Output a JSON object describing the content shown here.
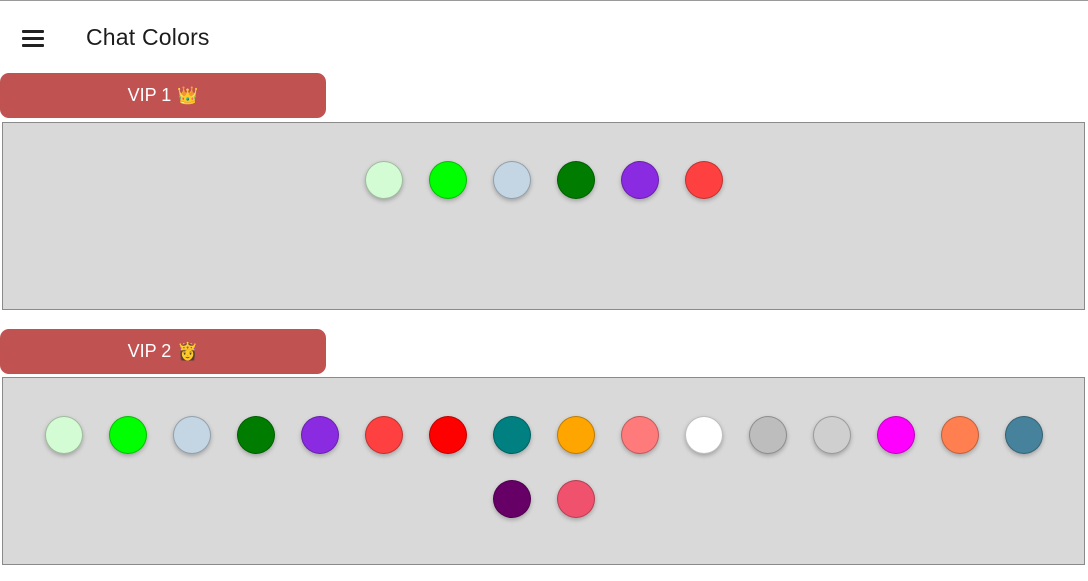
{
  "header": {
    "title": "Chat Colors",
    "menu_icon": "hamburger-menu-icon"
  },
  "tiers": [
    {
      "label": "VIP 1",
      "emoji": "👑",
      "colors": [
        "#d4fcd4",
        "#00ff00",
        "#c4d6e4",
        "#007d00",
        "#8a2be2",
        "#ff4040"
      ]
    },
    {
      "label": "VIP 2",
      "emoji": "👸",
      "colors": [
        "#d4fcd4",
        "#00ff00",
        "#c4d6e4",
        "#007d00",
        "#8a2be2",
        "#ff4040",
        "#ff0000",
        "#008080",
        "#ffa500",
        "#ff7a7a",
        "#ffffff",
        "#bdbdbd",
        "#cfcfcf",
        "#ff00ff",
        "#ff7f50",
        "#46829b",
        "#660066",
        "#f0526e"
      ]
    }
  ]
}
